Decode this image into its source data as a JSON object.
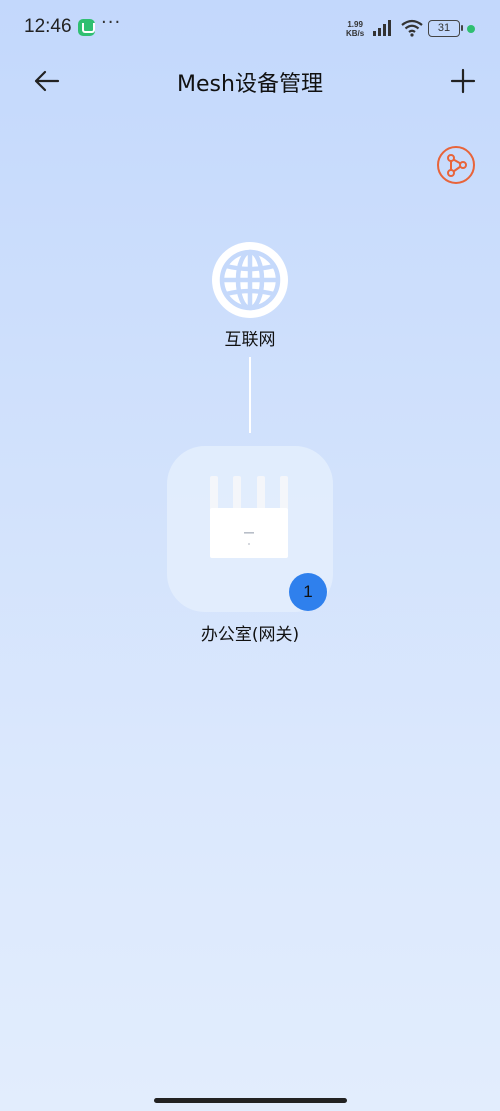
{
  "status_bar": {
    "time": "12:46",
    "net_speed_value": "1.99",
    "net_speed_unit": "KB/s",
    "battery": "31",
    "more": "···",
    "icons": [
      "mi-home-icon",
      "signal-icon",
      "wifi-icon",
      "battery-icon"
    ]
  },
  "header": {
    "title": "Mesh设备管理",
    "back_icon": "arrow-left-icon",
    "add_icon": "plus-icon",
    "topology_icon": "topology-icon"
  },
  "topology": {
    "internet_label": "互联网",
    "internet_icon": "globe-icon",
    "router": {
      "label": "办公室(网关)",
      "icon": "router-icon",
      "connected_count": "1"
    }
  },
  "colors": {
    "accent_orange": "#e8643a",
    "badge_blue": "#2f80ed",
    "status_green": "#2fbf71"
  }
}
